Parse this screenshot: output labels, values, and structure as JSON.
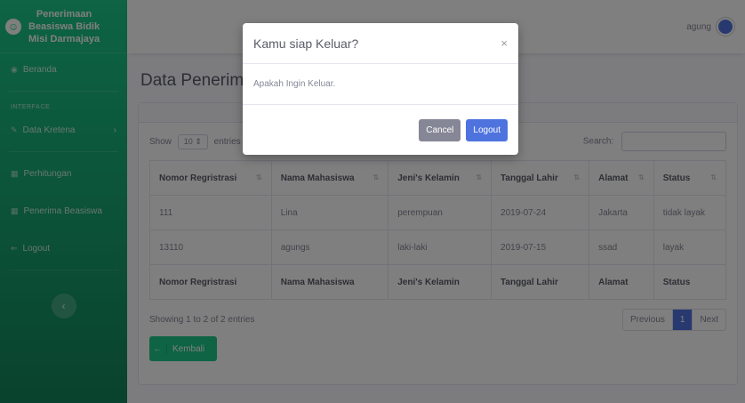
{
  "sidebar": {
    "brand_lines": [
      "Penerimaan",
      "Beasiswa Bidik",
      "Misi Darmajaya"
    ],
    "items": [
      {
        "label": "Beranda",
        "icon": "dashboard-icon"
      },
      {
        "label": "Data Kretena",
        "icon": "wrench-icon"
      },
      {
        "label": "Perhitungan",
        "icon": "table-icon"
      },
      {
        "label": "Penerima Beasiswa",
        "icon": "table-icon"
      },
      {
        "label": "Logout",
        "icon": "sign-out-icon"
      }
    ],
    "heading": "INTERFACE"
  },
  "topbar": {
    "user_name": "agung"
  },
  "page": {
    "title": "Data Penerima"
  },
  "table": {
    "show_label": "Show",
    "entries_value": "10",
    "entries_label": "entries",
    "search_label": "Search:",
    "columns": [
      "Nomor Regristrasi",
      "Nama Mahasiswa",
      "Jeni's Kelamin",
      "Tanggal Lahir",
      "Alamat",
      "Status"
    ],
    "rows": [
      [
        "111",
        "Lina",
        "perempuan",
        "2019-07-24",
        "Jakarta",
        "tidak layak"
      ],
      [
        "13110",
        "agungs",
        "laki-laki",
        "2019-07-15",
        "ssad",
        "layak"
      ]
    ],
    "info": "Showing 1 to 2 of 2 entries",
    "pager": {
      "previous": "Previous",
      "current": "1",
      "next": "Next"
    },
    "back_button": "Kembali"
  },
  "modal": {
    "title": "Kamu siap Keluar?",
    "close": "×",
    "body": "Apakah Ingin Keluar.",
    "cancel": "Cancel",
    "logout": "Logout"
  }
}
